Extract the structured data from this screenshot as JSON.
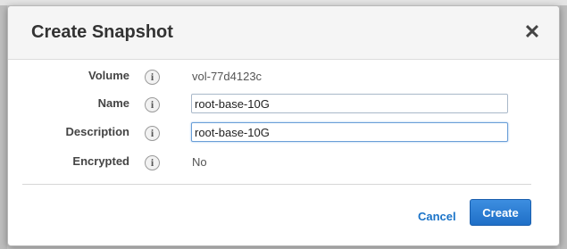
{
  "dialog": {
    "title": "Create Snapshot",
    "close_glyph": "✕"
  },
  "fields": {
    "volume": {
      "label": "Volume",
      "value": "vol-77d4123c",
      "info_icon": "i"
    },
    "name": {
      "label": "Name",
      "value": "root-base-10G",
      "info_icon": "i"
    },
    "description": {
      "label": "Description",
      "value": "root-base-10G",
      "info_icon": "i"
    },
    "encrypted": {
      "label": "Encrypted",
      "value": "No",
      "info_icon": "i"
    }
  },
  "actions": {
    "cancel_label": "Cancel",
    "create_label": "Create"
  },
  "colors": {
    "accent": "#1f6fc7",
    "link": "#1a73c8"
  }
}
